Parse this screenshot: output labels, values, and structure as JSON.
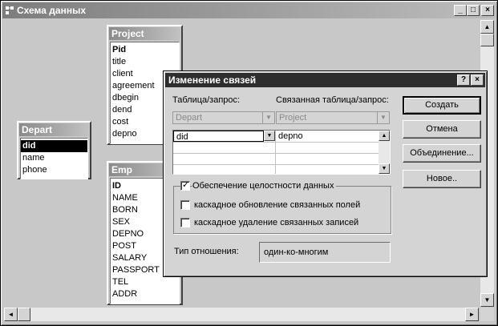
{
  "window": {
    "title": "Схема данных",
    "min_glyph": "_",
    "max_glyph": "□",
    "close_glyph": "×"
  },
  "scroll": {
    "up": "▲",
    "down": "▼",
    "left": "◄",
    "right": "►"
  },
  "tables": {
    "project": {
      "name": "Project",
      "fields": [
        "Pid",
        "title",
        "client",
        "agreement",
        "dbegin",
        "dend",
        "cost",
        "depno"
      ]
    },
    "depart": {
      "name": "Depart",
      "fields": [
        "did",
        "name",
        "phone"
      ]
    },
    "emp": {
      "name": "Emp",
      "fields": [
        "ID",
        "NAME",
        "BORN",
        "SEX",
        "DEPNO",
        "POST",
        "SALARY",
        "PASSPORT",
        "TEL",
        "ADDR"
      ]
    }
  },
  "dialog": {
    "title": "Изменение связей",
    "help_glyph": "?",
    "close_glyph": "×",
    "table_label": "Таблица/запрос:",
    "related_label": "Связанная таблица/запрос:",
    "table_value": "Depart",
    "related_value": "Project",
    "field_left": "did",
    "field_right": "depno",
    "dropdown_glyph": "▼",
    "buttons": {
      "create": "Создать",
      "cancel": "Отмена",
      "join": "Объединение...",
      "new": "Новое.."
    },
    "integrity": {
      "label": "Обеспечение целостности данных",
      "checked": true,
      "mark": "✓"
    },
    "cascade_update": {
      "label": "каскадное обновление связанных полей",
      "checked": false
    },
    "cascade_delete": {
      "label": "каскадное удаление связанных записей",
      "checked": false
    },
    "relation_type_label": "Тип отношения:",
    "relation_type_value": "один-ко-многим"
  }
}
